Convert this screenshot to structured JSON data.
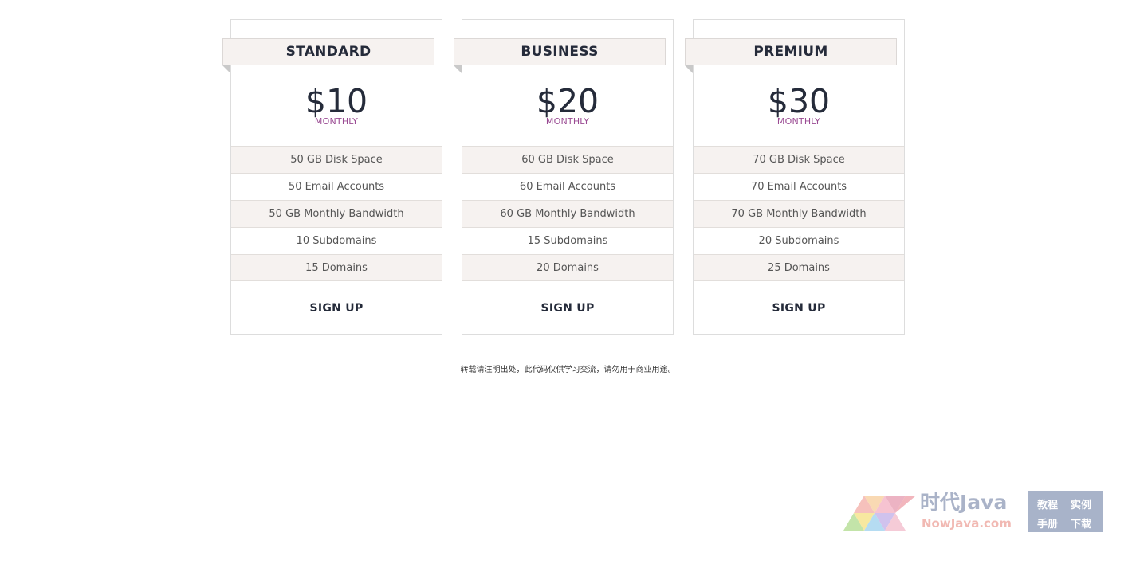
{
  "plans": [
    {
      "name": "STANDARD",
      "price": "$10",
      "period": "MONTHLY",
      "features": [
        "50 GB Disk Space",
        "50 Email Accounts",
        "50 GB Monthly Bandwidth",
        "10 Subdomains",
        "15 Domains"
      ],
      "cta": "SIGN UP"
    },
    {
      "name": "BUSINESS",
      "price": "$20",
      "period": "MONTHLY",
      "features": [
        "60 GB Disk Space",
        "60 Email Accounts",
        "60 GB Monthly Bandwidth",
        "15 Subdomains",
        "20 Domains"
      ],
      "cta": "SIGN UP"
    },
    {
      "name": "PREMIUM",
      "price": "$30",
      "period": "MONTHLY",
      "features": [
        "70 GB Disk Space",
        "70 Email Accounts",
        "70 GB Monthly Bandwidth",
        "20 Subdomains",
        "25 Domains"
      ],
      "cta": "SIGN UP"
    }
  ],
  "notice": "转载请注明出处，此代码仅供学习交流，请勿用于商业用途。",
  "watermark": {
    "title": "时代Java",
    "url": "NowJava.com",
    "links": [
      "教程",
      "实例",
      "手册",
      "下载"
    ]
  },
  "colors": {
    "heading": "#252b3a",
    "period": "#9a4b93",
    "stripe": "#f6f2f0"
  }
}
